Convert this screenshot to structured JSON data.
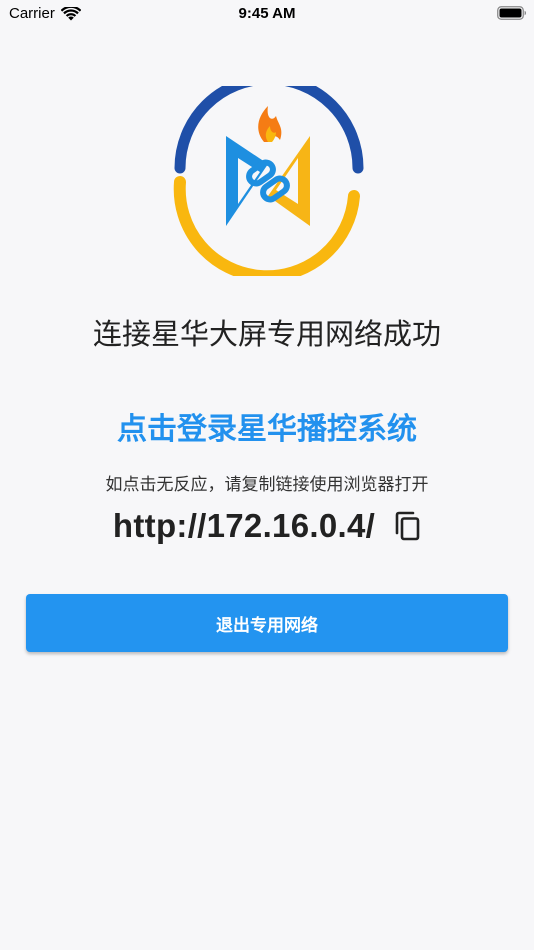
{
  "status_bar": {
    "carrier": "Carrier",
    "time": "9:45 AM",
    "wifi_icon": "wifi-icon",
    "battery_icon": "battery-full-icon"
  },
  "logo": {
    "icon": "xinghua-logo-icon",
    "colors": {
      "ring_blue": "#1f4fa8",
      "ring_yellow": "#f9b70f",
      "mark_blue": "#1e8fe0",
      "mark_yellow": "#f7b516",
      "flame_orange": "#f57c14"
    }
  },
  "main": {
    "connect_title": "连接星华大屏专用网络成功",
    "login_link": "点击登录星华播控系统",
    "hint": "如点击无反应，请复制链接使用浏览器打开",
    "url": "http://172.16.0.4/",
    "copy_icon": "copy-icon"
  },
  "actions": {
    "exit_label": "退出专用网络"
  },
  "colors": {
    "accent": "#2394f0",
    "link": "#2291ee",
    "background": "#f7f7f9"
  }
}
